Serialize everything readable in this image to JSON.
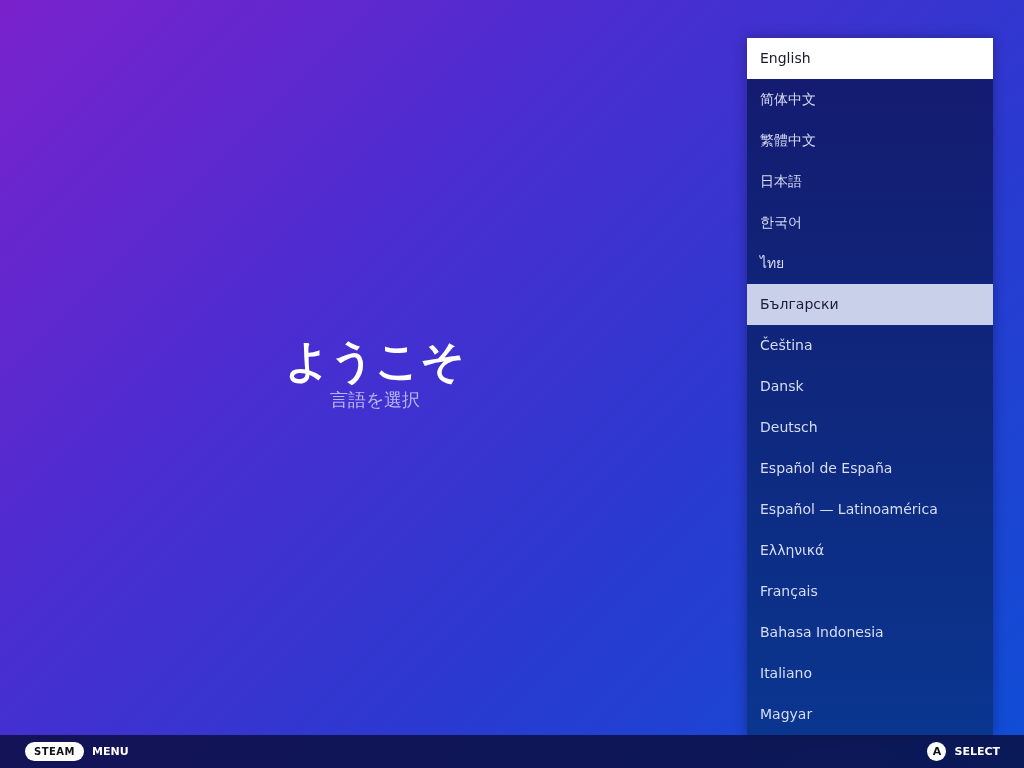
{
  "welcome": {
    "title": "ようこそ",
    "subtitle": "言語を選択"
  },
  "language_list": {
    "items": [
      {
        "label": "English",
        "selected": true,
        "hovered": false
      },
      {
        "label": "简体中文",
        "selected": false,
        "hovered": false
      },
      {
        "label": "繁體中文",
        "selected": false,
        "hovered": false
      },
      {
        "label": "日本語",
        "selected": false,
        "hovered": false
      },
      {
        "label": "한국어",
        "selected": false,
        "hovered": false
      },
      {
        "label": "ไทย",
        "selected": false,
        "hovered": false
      },
      {
        "label": "Български",
        "selected": false,
        "hovered": true
      },
      {
        "label": "Čeština",
        "selected": false,
        "hovered": false
      },
      {
        "label": "Dansk",
        "selected": false,
        "hovered": false
      },
      {
        "label": "Deutsch",
        "selected": false,
        "hovered": false
      },
      {
        "label": "Español de España",
        "selected": false,
        "hovered": false
      },
      {
        "label": "Español — Latinoamérica",
        "selected": false,
        "hovered": false
      },
      {
        "label": "Ελληνικά",
        "selected": false,
        "hovered": false
      },
      {
        "label": "Français",
        "selected": false,
        "hovered": false
      },
      {
        "label": "Bahasa Indonesia",
        "selected": false,
        "hovered": false
      },
      {
        "label": "Italiano",
        "selected": false,
        "hovered": false
      },
      {
        "label": "Magyar",
        "selected": false,
        "hovered": false
      }
    ]
  },
  "footer": {
    "left": {
      "button": "STEAM",
      "label": "MENU"
    },
    "right": {
      "button": "A",
      "label": "SELECT"
    }
  }
}
